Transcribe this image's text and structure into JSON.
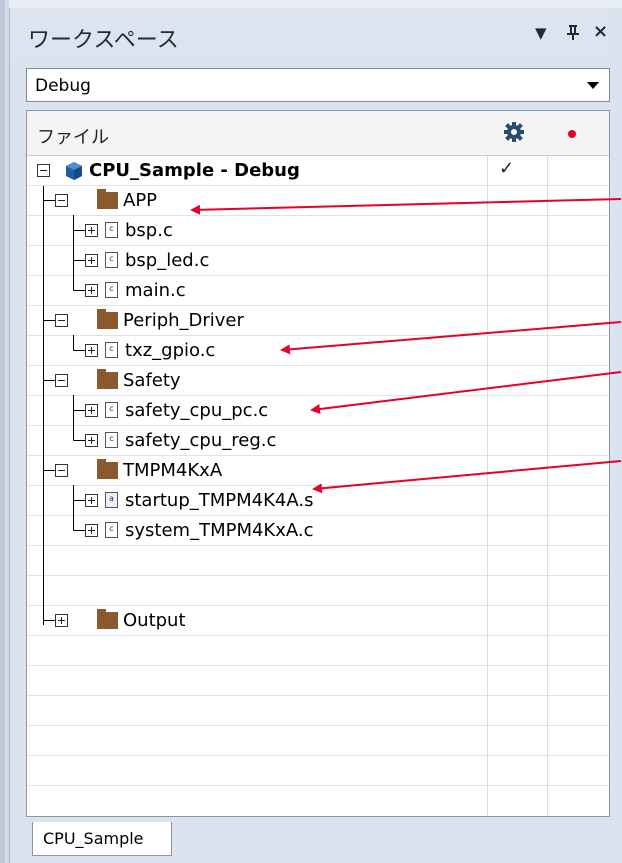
{
  "panel": {
    "title": "ワークスペース",
    "dropdown_glyph": "▼",
    "pin_glyph": "ᵖ",
    "close_glyph": "×"
  },
  "config": {
    "selected": "Debug"
  },
  "header": {
    "file_label": "ファイル",
    "build_icon": "gear-icon",
    "breakpoint_icon": "red-dot-icon"
  },
  "tree": {
    "project": "CPU_Sample - Debug",
    "project_check": "✓",
    "groups": [
      {
        "name": "APP",
        "files": [
          "bsp.c",
          "bsp_led.c",
          "main.c"
        ]
      },
      {
        "name": "Periph_Driver",
        "files": [
          "txz_gpio.c"
        ]
      },
      {
        "name": "Safety",
        "files": [
          "safety_cpu_pc.c",
          "safety_cpu_reg.c"
        ]
      },
      {
        "name": "TMPM4KxA",
        "files": [
          "startup_TMPM4K4A.s",
          "system_TMPM4KxA.c"
        ]
      },
      {
        "name": "Output",
        "files": []
      }
    ]
  },
  "tabs": [
    {
      "label": "CPU_Sample"
    }
  ],
  "colors": {
    "accent_arrow": "#e8002a",
    "folder": "#8a5a2e",
    "panel_bg": "#dbe3ef"
  }
}
